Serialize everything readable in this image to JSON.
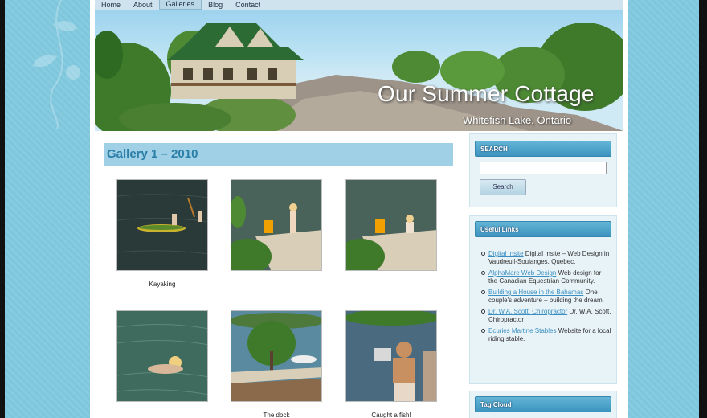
{
  "nav": {
    "items": [
      "Home",
      "About",
      "Galleries",
      "Blog",
      "Contact"
    ],
    "active": "Galleries"
  },
  "banner": {
    "title": "Our Summer Cottage",
    "subtitle": "Whitefish Lake, Ontario"
  },
  "gallery": {
    "heading": "Gallery 1 – 2010",
    "items": [
      {
        "caption": "Kayaking"
      },
      {
        "caption": ""
      },
      {
        "caption": ""
      },
      {
        "caption": ""
      },
      {
        "caption": "The dock"
      },
      {
        "caption": "Caught a fish!"
      }
    ]
  },
  "sidebar": {
    "search": {
      "heading": "SEARCH",
      "placeholder": "",
      "button": "Search"
    },
    "links": {
      "heading": "Useful Links",
      "items": [
        {
          "link": "Digital Insite",
          "text": " Digital Insite – Web Design in Vaudreuil-Soulanges, Quebec."
        },
        {
          "link": "AlphaMare Web Design",
          "text": " Web design for the Canadian Equestrian Community."
        },
        {
          "link": "Building a House in the Bahamas",
          "text": " One couple's adventure – building the dream."
        },
        {
          "link": "Dr. W.A. Scott, Chiropractor",
          "text": " Dr. W.A. Scott, Chiropractor"
        },
        {
          "link": "Ecuries Martine Stables",
          "text": " Website for a local riding stable."
        }
      ]
    },
    "tagcloud": {
      "heading": "Tag Cloud"
    }
  },
  "colors": {
    "accent": "#2a7ea7",
    "header_band": "#9fd0e5",
    "link": "#3b8fc0",
    "background": "#7fc6dc"
  }
}
